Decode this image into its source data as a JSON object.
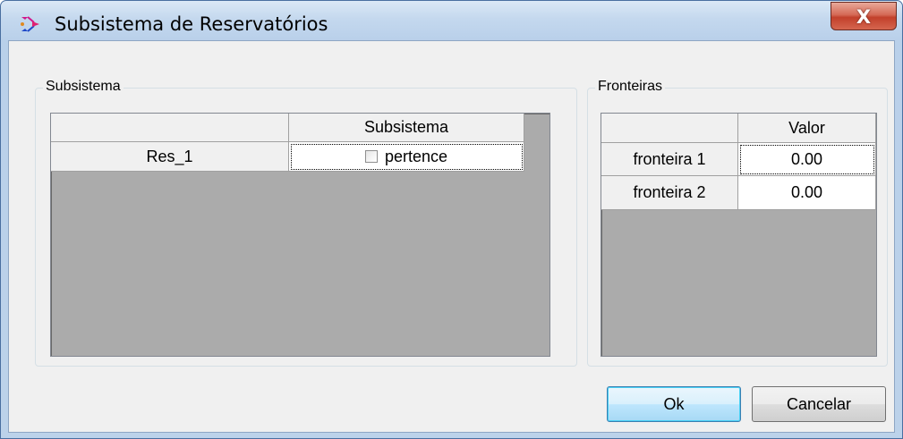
{
  "window": {
    "title": "Subsistema de Reservatórios",
    "close_label": "X"
  },
  "subsistema_group": {
    "label": "Subsistema",
    "grid": {
      "columns": [
        "",
        "Subsistema"
      ],
      "rows": [
        {
          "name": "Res_1",
          "checkbox_label": "pertence",
          "checked": false
        }
      ]
    }
  },
  "fronteiras_group": {
    "label": "Fronteiras",
    "grid": {
      "columns": [
        "",
        "Valor"
      ],
      "rows": [
        {
          "name": "fronteira 1",
          "value": "0.00"
        },
        {
          "name": "fronteira 2",
          "value": "0.00"
        }
      ]
    }
  },
  "buttons": {
    "ok_label": "Ok",
    "cancel_label": "Cancelar"
  }
}
